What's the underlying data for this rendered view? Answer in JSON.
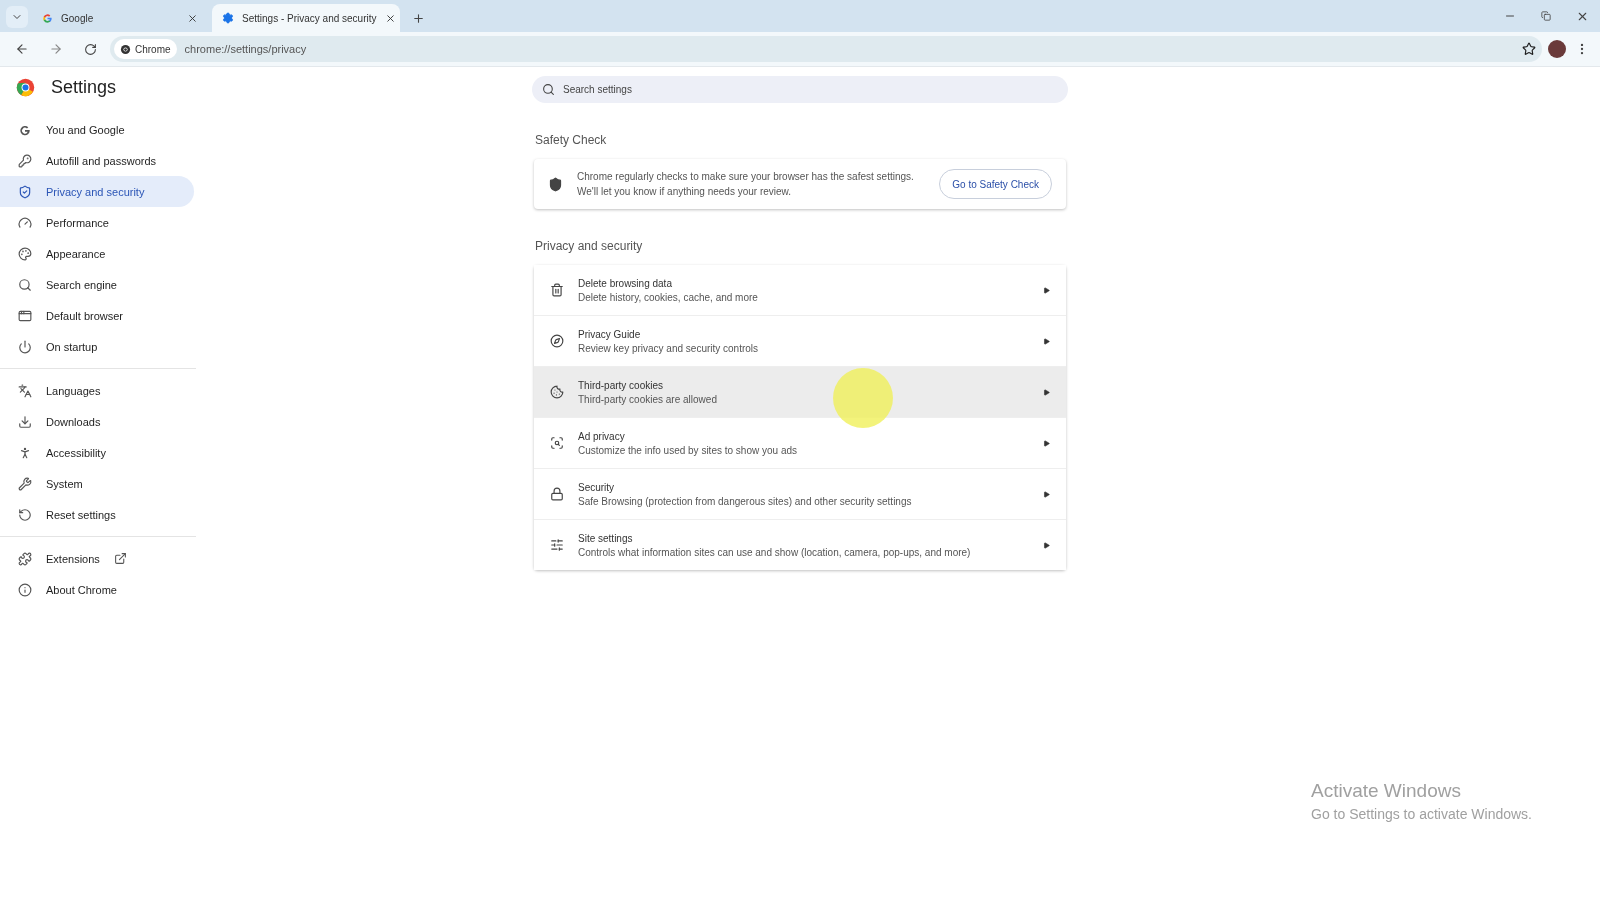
{
  "browser": {
    "tabs": [
      {
        "title": "Google",
        "selected": false,
        "kind": "google"
      },
      {
        "title": "Settings - Privacy and security",
        "selected": true,
        "kind": "settings"
      }
    ],
    "address": {
      "chip": "Chrome",
      "url": "chrome://settings/privacy"
    }
  },
  "header": {
    "title": "Settings",
    "search": {
      "placeholder": "Search settings"
    }
  },
  "sidebar": {
    "groups": [
      [
        {
          "label": "You and Google",
          "selected": false,
          "external": false
        },
        {
          "label": "Autofill and passwords",
          "selected": false,
          "external": false
        },
        {
          "label": "Privacy and security",
          "selected": true,
          "external": false
        },
        {
          "label": "Performance",
          "selected": false,
          "external": false
        },
        {
          "label": "Appearance",
          "selected": false,
          "external": false
        },
        {
          "label": "Search engine",
          "selected": false,
          "external": false
        },
        {
          "label": "Default browser",
          "selected": false,
          "external": false
        },
        {
          "label": "On startup",
          "selected": false,
          "external": false
        }
      ],
      [
        {
          "label": "Languages",
          "selected": false,
          "external": false
        },
        {
          "label": "Downloads",
          "selected": false,
          "external": false
        },
        {
          "label": "Accessibility",
          "selected": false,
          "external": false
        },
        {
          "label": "System",
          "selected": false,
          "external": false
        },
        {
          "label": "Reset settings",
          "selected": false,
          "external": false
        }
      ],
      [
        {
          "label": "Extensions",
          "selected": false,
          "external": true
        },
        {
          "label": "About Chrome",
          "selected": false,
          "external": false
        }
      ]
    ]
  },
  "safety_check": {
    "heading": "Safety Check",
    "text": "Chrome regularly checks to make sure your browser has the safest settings.\nWe'll let you know if anything needs your review.",
    "button": "Go to Safety Check"
  },
  "privacy": {
    "heading": "Privacy and security",
    "rows": [
      {
        "title": "Delete browsing data",
        "subtitle": "Delete history, cookies, cache, and more",
        "hovered": false
      },
      {
        "title": "Privacy Guide",
        "subtitle": "Review key privacy and security controls",
        "hovered": false
      },
      {
        "title": "Third-party cookies",
        "subtitle": "Third-party cookies are allowed",
        "hovered": true
      },
      {
        "title": "Ad privacy",
        "subtitle": "Customize the info used by sites to show you ads",
        "hovered": false
      },
      {
        "title": "Security",
        "subtitle": "Safe Browsing (protection from dangerous sites) and other security settings",
        "hovered": false
      },
      {
        "title": "Site settings",
        "subtitle": "Controls what information sites can use and show (location, camera, pop-ups, and more)",
        "hovered": false
      }
    ]
  },
  "os_notice": {
    "title": "Activate Windows",
    "subtitle": "Go to Settings to activate Windows."
  }
}
